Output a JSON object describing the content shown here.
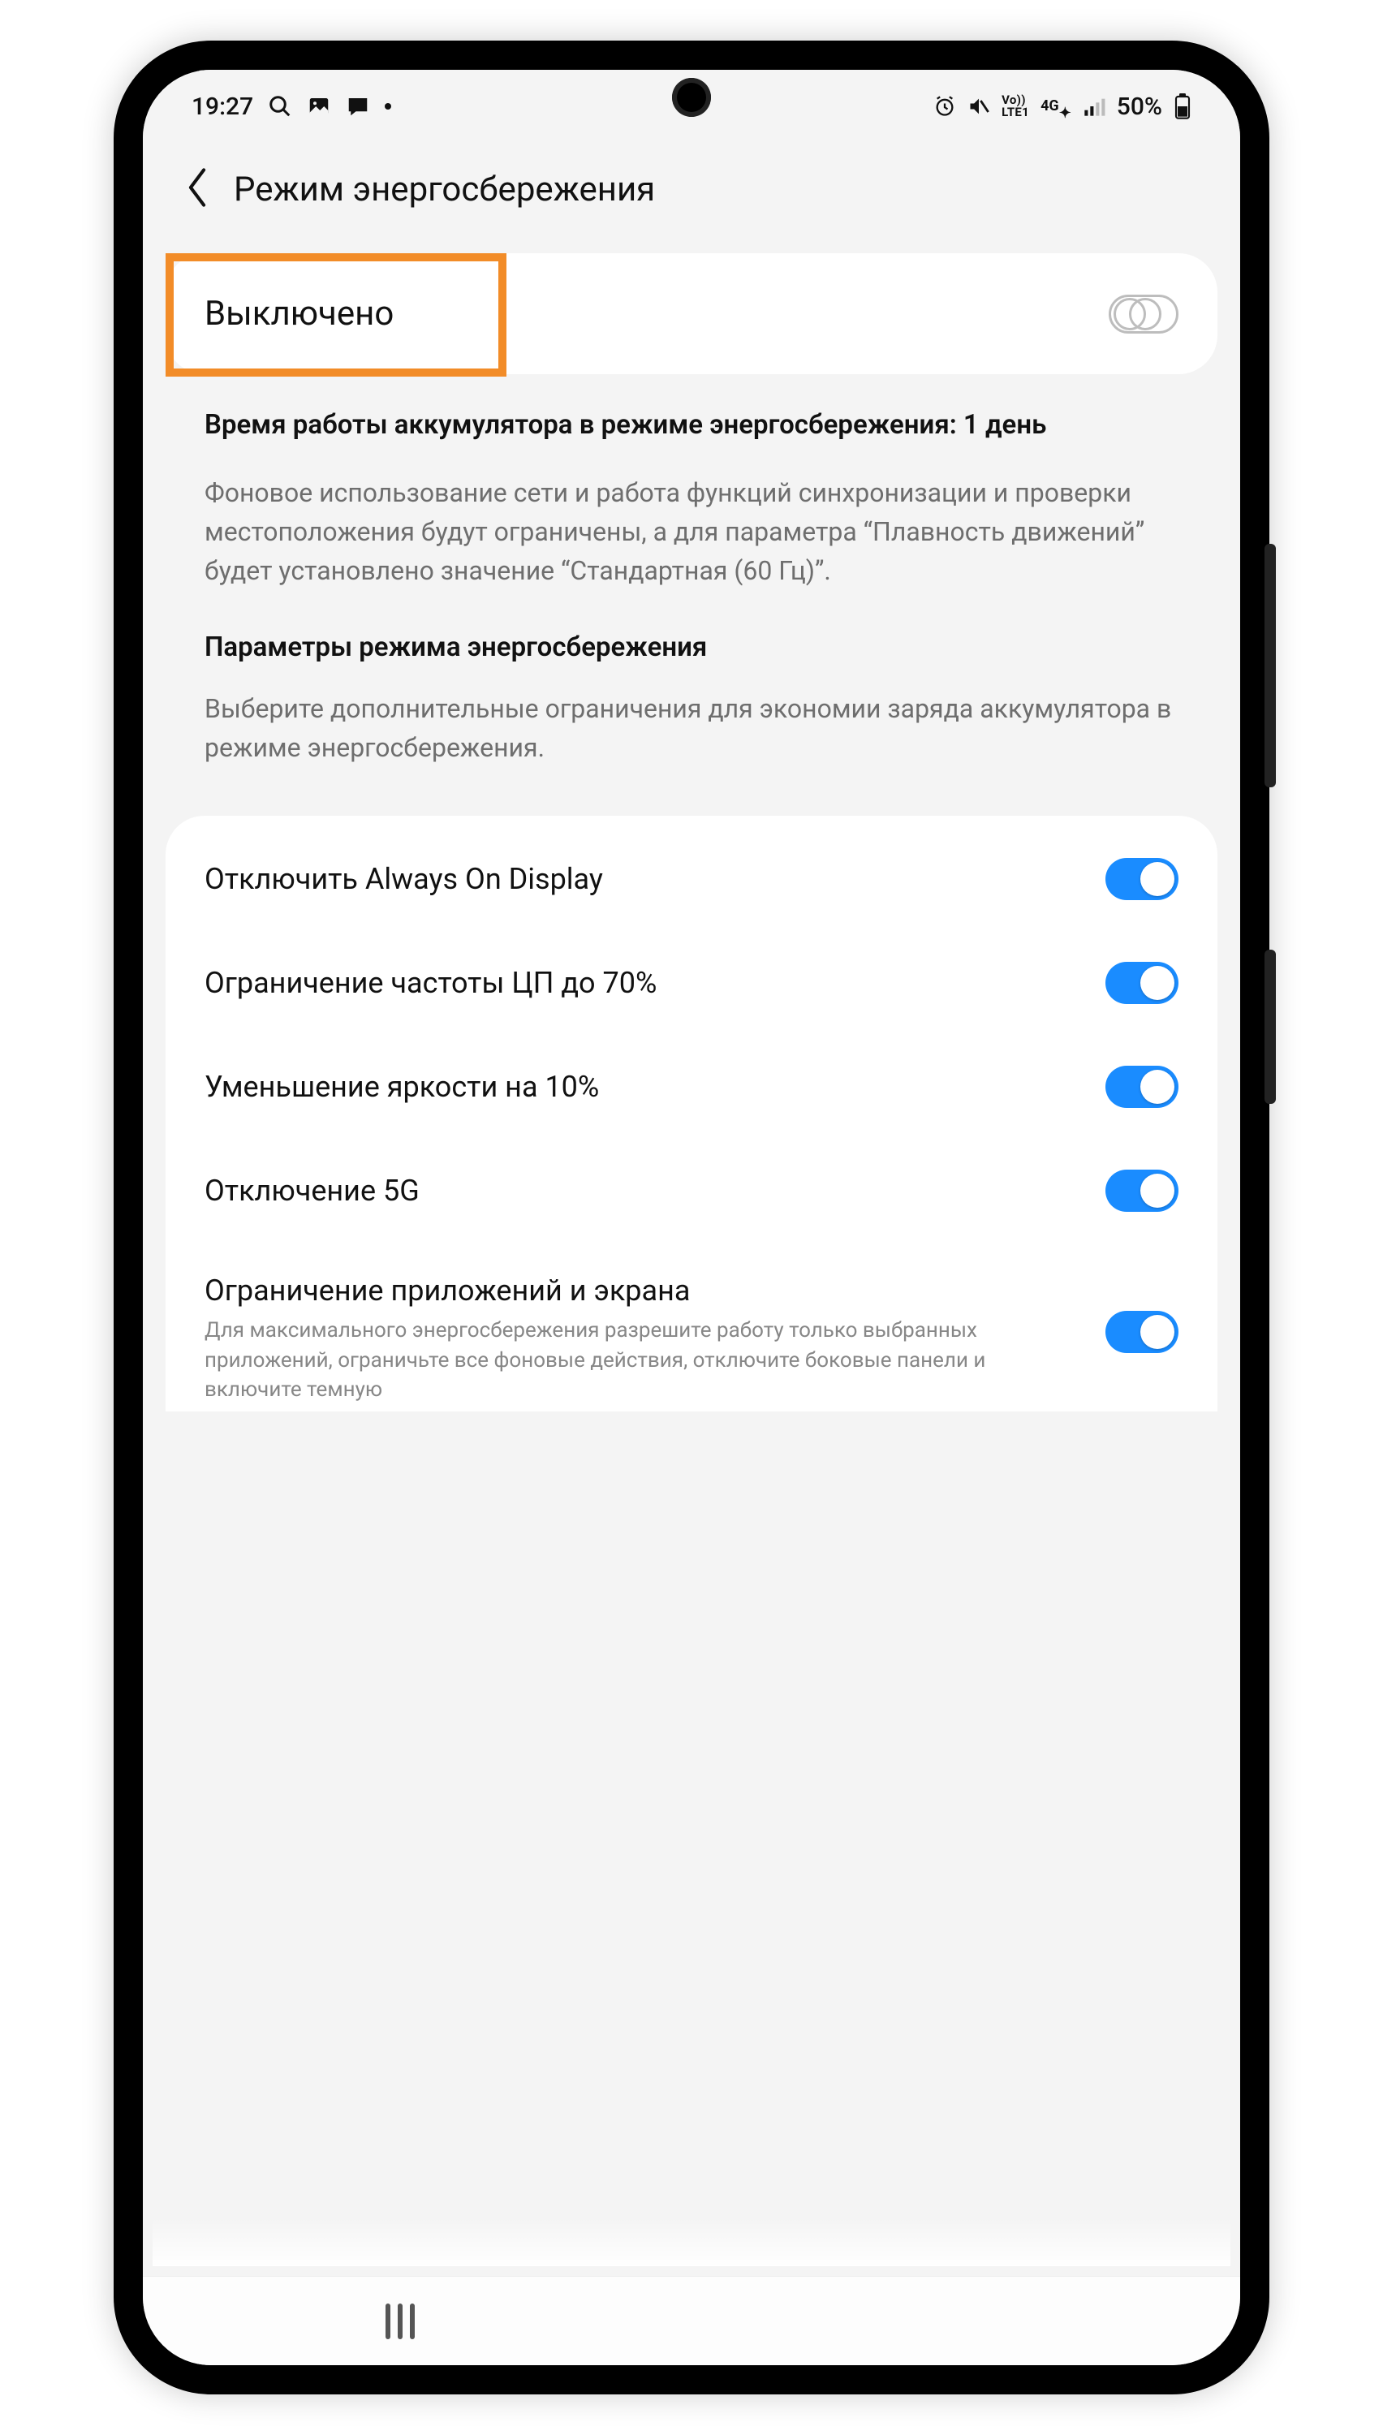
{
  "status_bar": {
    "time": "19:27",
    "battery": "50%",
    "network": "4G"
  },
  "header": {
    "title": "Режим энергосбережения"
  },
  "master_toggle": {
    "label": "Выключено",
    "state": "off"
  },
  "info": {
    "estimated_title": "Время работы аккумулятора в режиме энергосбережения: 1 день",
    "description": "Фоновое использование сети и работа функций синхронизации и проверки местоположения будут ограничены, а для параметра “Плавность движений” будет установлено значение “Стандартная (60 Гц)”.",
    "params_title": "Параметры режима энергосбережения",
    "params_desc": "Выберите дополнительные ограничения для экономии заряда аккумулятора в режиме энергосбережения."
  },
  "options": [
    {
      "label": "Отключить Always On Display",
      "on": true
    },
    {
      "label": "Ограничение частоты ЦП до 70%",
      "on": true
    },
    {
      "label": "Уменьшение яркости на 10%",
      "on": true
    },
    {
      "label": "Отключение 5G",
      "on": true
    },
    {
      "label": "Ограничение приложений и экрана",
      "on": true,
      "desc": "Для максимального энергосбережения разрешите работу только выбранных приложений, ограничьте все фоновые действия, отключите боковые панели и включите темную"
    }
  ],
  "highlight_color": "#f28c28",
  "accent_color": "#1a8cff"
}
